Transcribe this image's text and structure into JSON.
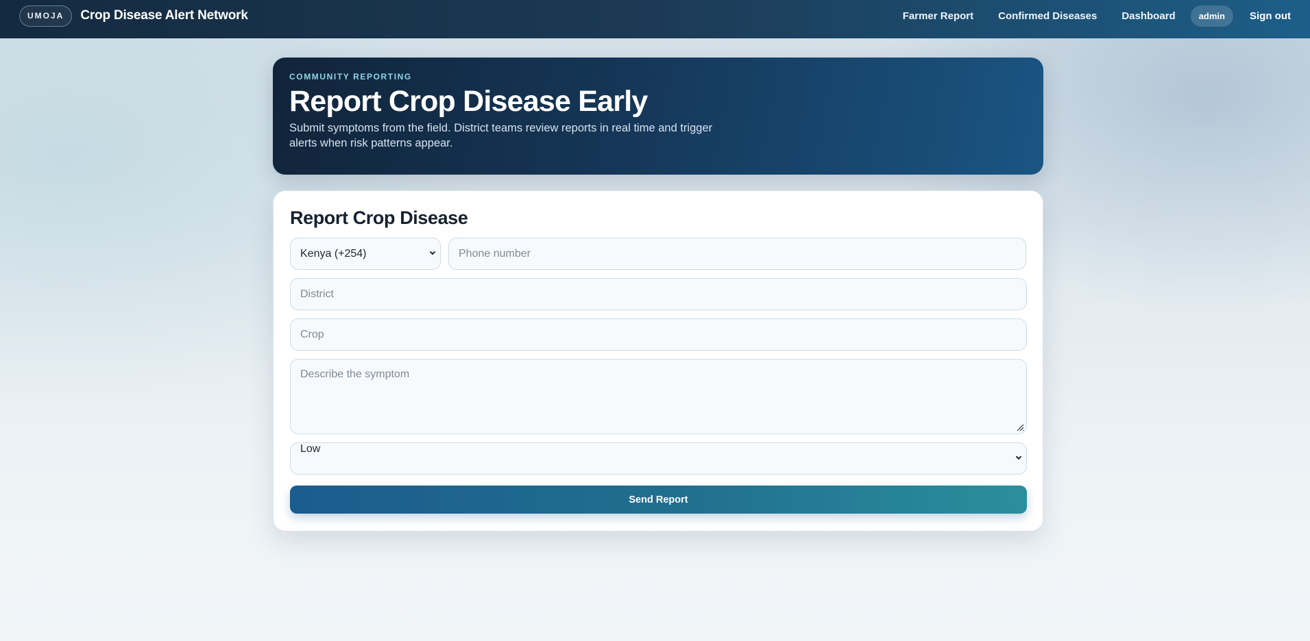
{
  "header": {
    "brand_badge": "UMOJA",
    "app_title": "Crop Disease Alert Network",
    "nav": [
      {
        "label": "Farmer Report"
      },
      {
        "label": "Confirmed Diseases"
      },
      {
        "label": "Dashboard"
      }
    ],
    "user": "admin",
    "signout_label": "Sign out"
  },
  "hero": {
    "eyebrow": "COMMUNITY REPORTING",
    "title": "Report Crop Disease Early",
    "description": "Submit symptoms from the field. District teams review reports in real time and trigger alerts when risk patterns appear."
  },
  "form": {
    "title": "Report Crop Disease",
    "country_value": "Kenya (+254)",
    "phone_placeholder": "Phone number",
    "phone_value": "",
    "district_placeholder": "District",
    "district_value": "",
    "crop_placeholder": "Crop",
    "crop_value": "",
    "symptom_placeholder": "Describe the symptom",
    "severity_value": "Low",
    "submit_label": "Send Report"
  },
  "colors": {
    "topbar_start": "#142a40",
    "topbar_end": "#1d5e88",
    "hero_start": "#11243a",
    "hero_end": "#1a5583",
    "accent_eyebrow": "#8fd6e6",
    "button_start": "#1b5c8e",
    "button_end": "#2a8f9d"
  }
}
